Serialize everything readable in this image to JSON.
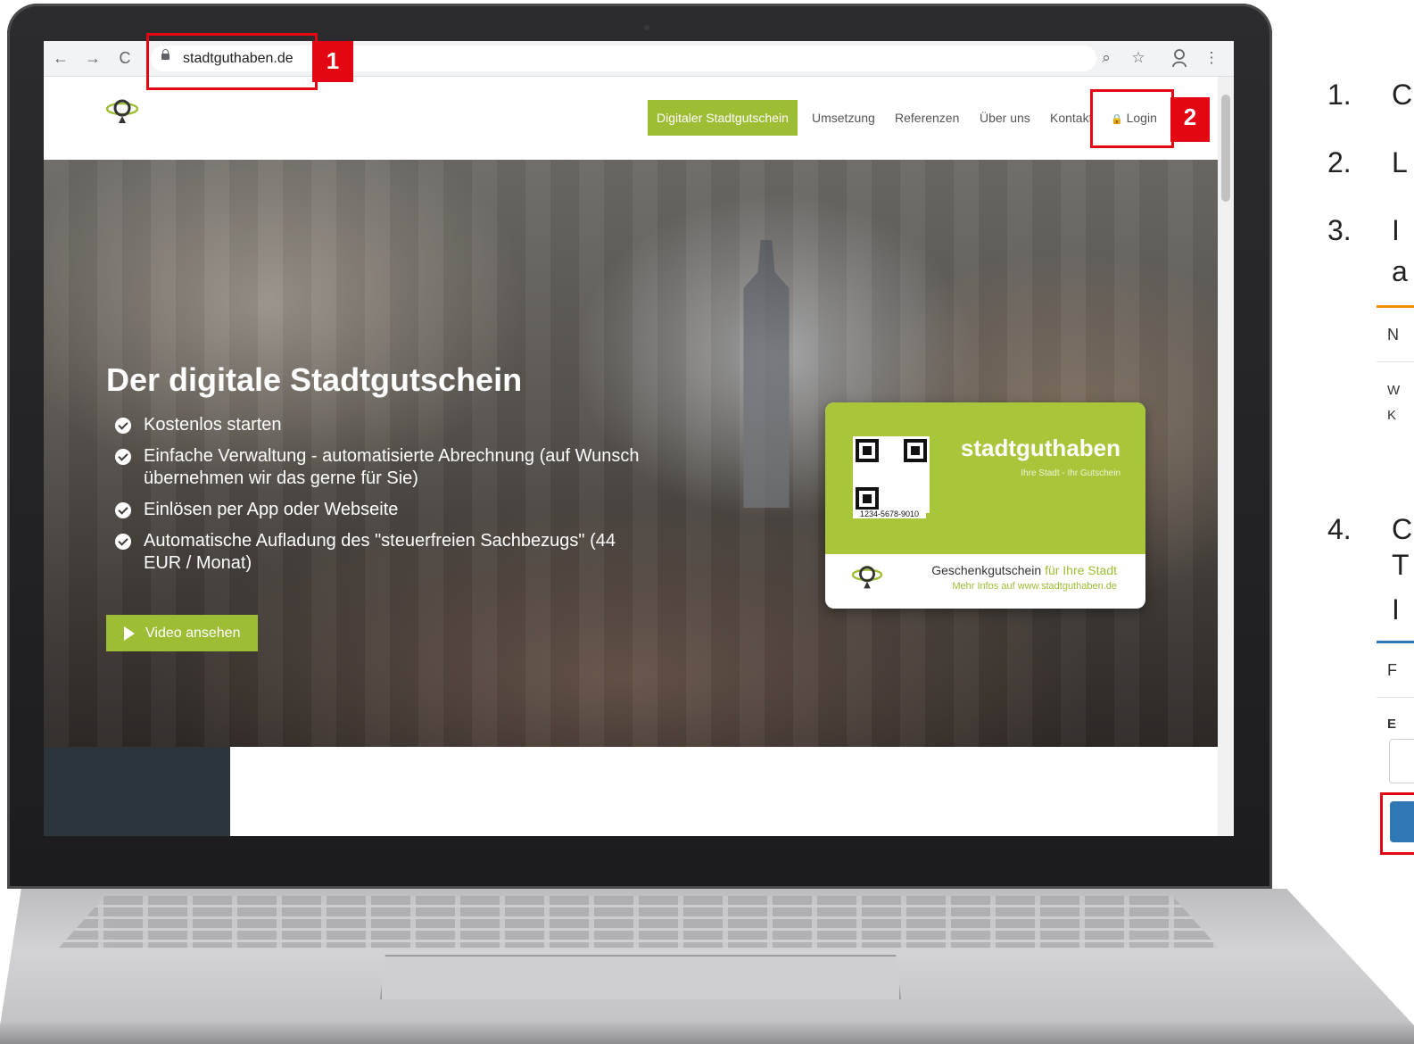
{
  "browser": {
    "url": "stadtguthaben.de",
    "back": "←",
    "forward": "→",
    "reload": "C",
    "zoom": "⌕",
    "star": "☆",
    "menu": "⋮"
  },
  "nav": {
    "items": [
      "Digitaler Stadtgutschein",
      "Umsetzung",
      "Referenzen",
      "Über uns",
      "Kontakt"
    ],
    "login": "Login",
    "lock_glyph": "🔒"
  },
  "hero": {
    "title": "Der digitale Stadtgutschein",
    "bullets": [
      "Kostenlos starten",
      "Einfache Verwaltung - automatisierte Abrechnung (auf Wunsch übernehmen wir das gerne für Sie)",
      "Einlösen per App oder Webseite",
      "Automatische Aufladung des \"steuerfreien Sachbezugs\" (44 EUR / Monat)"
    ],
    "video_button": "Video ansehen"
  },
  "card": {
    "brand": "stadtguthaben",
    "tagline": "Ihre Stadt - Ihr Gutschein",
    "code": "1234-5678-9010",
    "line1_main": "Geschenkgutschein",
    "line1_accent": "für Ihre Stadt",
    "line2": "Mehr Infos auf www.stadtguthaben.de"
  },
  "annotations": {
    "marker1": "1",
    "marker2": "2"
  },
  "instructions": {
    "steps": [
      "1.",
      "2.",
      "3.",
      "4."
    ],
    "fragments": {
      "s1": "C",
      "s2": "L",
      "s3a": "I",
      "s3b": "a",
      "s4a": "C",
      "s4b": "T",
      "s4c": "I"
    },
    "panel1": {
      "title": "N",
      "line1": "W",
      "line2": "K"
    },
    "panel2": {
      "title": "F",
      "label": "E"
    }
  },
  "colors": {
    "brand_green": "#9dbd34",
    "annotation_red": "#e30613",
    "panel_orange": "#f39200",
    "panel_blue": "#2f77b5"
  }
}
